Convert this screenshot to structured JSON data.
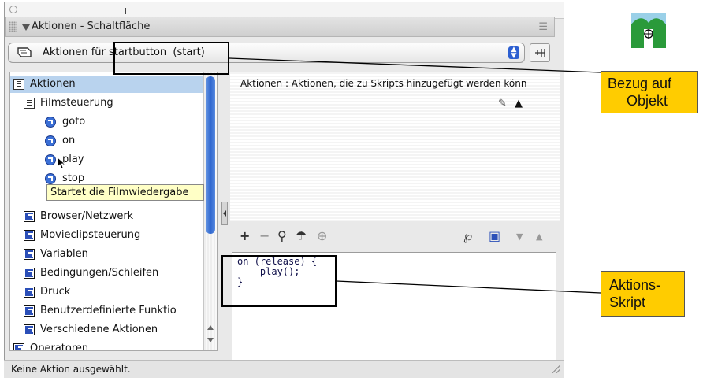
{
  "window": {
    "panel_title": "Aktionen - Schaltfläche",
    "toolbar_label": "Aktionen für startbutton  (start)"
  },
  "tree": {
    "items": [
      {
        "label": "Aktionen",
        "icon": "book-icon",
        "selected": true
      },
      {
        "label": "Filmsteuerung",
        "icon": "book-icon"
      },
      {
        "label": "goto",
        "icon": "action-circle-icon"
      },
      {
        "label": "on",
        "icon": "action-circle-icon"
      },
      {
        "label": "play",
        "icon": "action-circle-icon"
      },
      {
        "label": "stop",
        "icon": "action-circle-icon"
      },
      {
        "label": "Browser/Netzwerk",
        "icon": "category-icon"
      },
      {
        "label": "Movieclipsteuerung",
        "icon": "category-icon"
      },
      {
        "label": "Variablen",
        "icon": "category-icon"
      },
      {
        "label": "Bedingungen/Schleifen",
        "icon": "category-icon"
      },
      {
        "label": "Druck",
        "icon": "category-icon"
      },
      {
        "label": "Benutzerdefinierte Funktio",
        "icon": "category-icon"
      },
      {
        "label": "Verschiedene Aktionen",
        "icon": "category-icon"
      },
      {
        "label": "Operatoren",
        "icon": "category-icon"
      }
    ],
    "tooltip": "Startet die Filmwiedergabe"
  },
  "description": {
    "text": "Aktionen : Aktionen, die zu Skripts hinzugefügt werden könn"
  },
  "editor": {
    "code": "on (release) {\n    play();\n}"
  },
  "status": {
    "text": "Keine Aktion ausgewählt."
  },
  "annotations": {
    "callout1": [
      "Bezug auf",
      "Objekt"
    ],
    "callout2": [
      "Aktions-",
      "Skript"
    ]
  },
  "colors": {
    "callout": "#ffcc00",
    "selection": "#b9d3ee",
    "tooltip": "#ffffc6",
    "logo": "#2a9a3a"
  }
}
